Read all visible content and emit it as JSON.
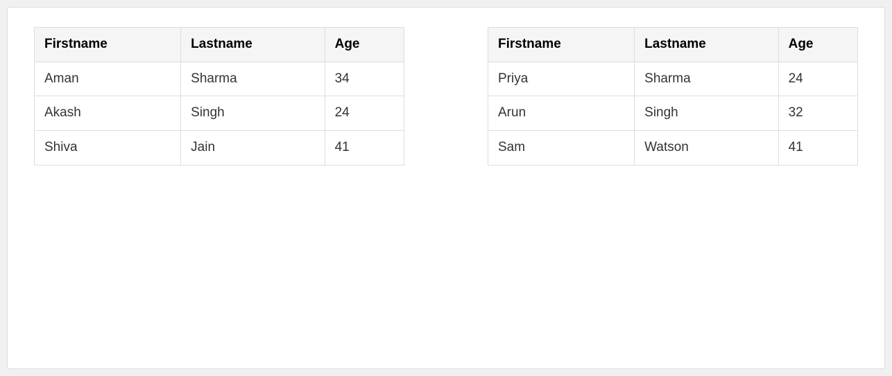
{
  "tables": [
    {
      "headers": [
        "Firstname",
        "Lastname",
        "Age"
      ],
      "rows": [
        {
          "firstname": "Aman",
          "lastname": "Sharma",
          "age": "34"
        },
        {
          "firstname": "Akash",
          "lastname": "Singh",
          "age": "24"
        },
        {
          "firstname": "Shiva",
          "lastname": "Jain",
          "age": "41"
        }
      ]
    },
    {
      "headers": [
        "Firstname",
        "Lastname",
        "Age"
      ],
      "rows": [
        {
          "firstname": "Priya",
          "lastname": "Sharma",
          "age": "24"
        },
        {
          "firstname": "Arun",
          "lastname": "Singh",
          "age": "32"
        },
        {
          "firstname": "Sam",
          "lastname": "Watson",
          "age": "41"
        }
      ]
    }
  ]
}
